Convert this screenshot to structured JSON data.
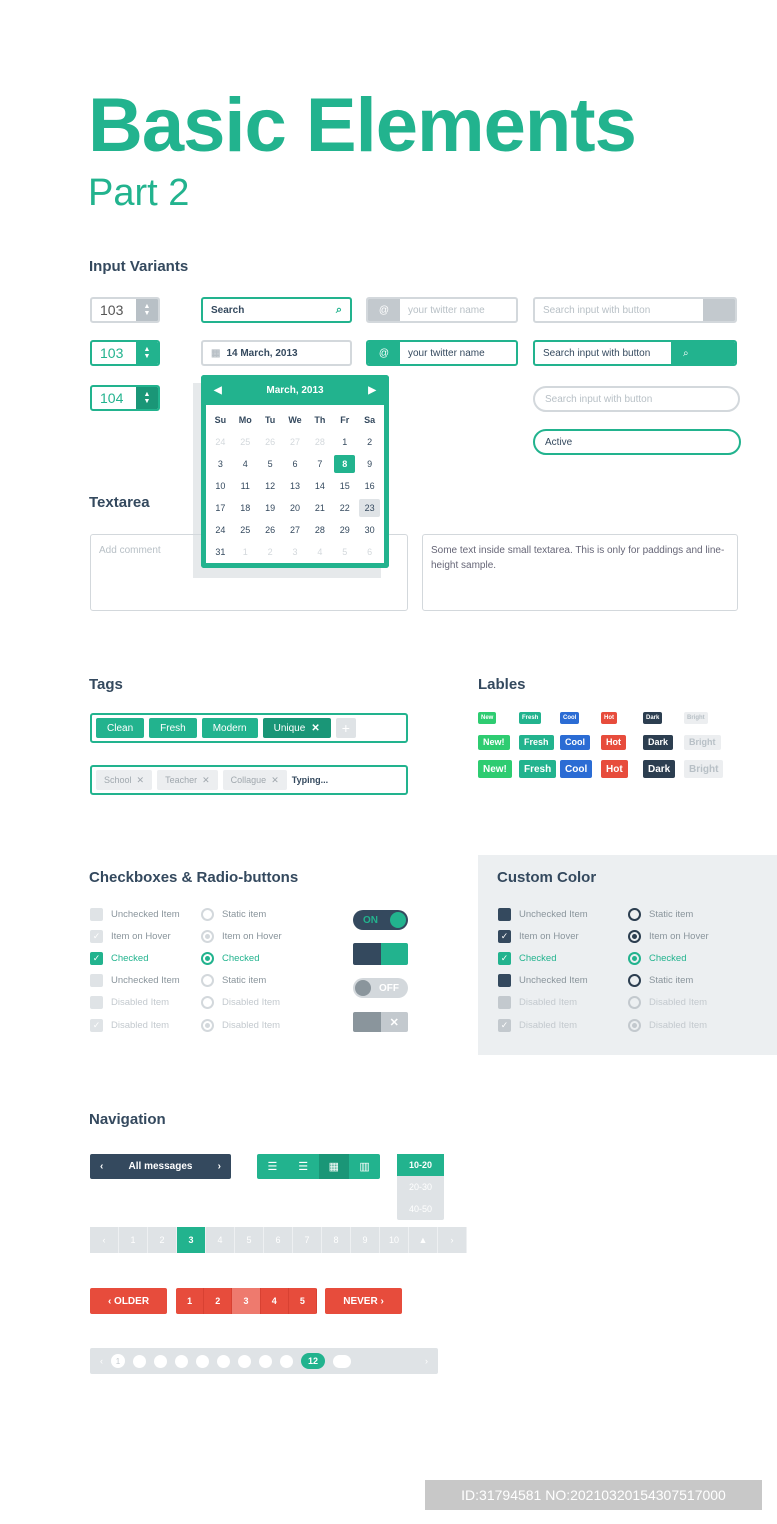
{
  "title": "Basic Elements",
  "subtitle": "Part 2",
  "colors": {
    "accent": "#22b38e",
    "dark": "#34495e",
    "red": "#e74c3c",
    "blue": "#2b6cd4",
    "grey": "#dfe3e6"
  },
  "inputs": {
    "heading": "Input Variants",
    "stepper1": "103",
    "stepper2": "103",
    "stepper3": "104",
    "search": "Search",
    "date": "14 March, 2013",
    "twitter_placeholder": "your twitter name",
    "twitter_value": "your twitter name",
    "sib_placeholder": "Search input with button",
    "sib_value": "Search input with button",
    "rounded_placeholder": "Search input with button",
    "active": "Active"
  },
  "calendar": {
    "month": "March, 2013",
    "weekdays": [
      "Su",
      "Mo",
      "Tu",
      "We",
      "Th",
      "Fr",
      "Sa"
    ],
    "days": [
      "24",
      "25",
      "26",
      "27",
      "28",
      "1",
      "2",
      "3",
      "4",
      "5",
      "6",
      "7",
      "8",
      "9",
      "10",
      "11",
      "12",
      "13",
      "14",
      "15",
      "16",
      "17",
      "18",
      "19",
      "20",
      "21",
      "22",
      "23",
      "24",
      "25",
      "26",
      "27",
      "28",
      "29",
      "30",
      "31",
      "1",
      "2",
      "3",
      "4",
      "5",
      "6"
    ],
    "selected": "8",
    "hover": "23"
  },
  "textarea": {
    "heading": "Textarea",
    "placeholder": "Add comment",
    "sample": "Some text inside small textarea. This is only for paddings and line-height sample."
  },
  "tags": {
    "heading": "Tags",
    "set1": [
      "Clean",
      "Fresh",
      "Modern",
      "Unique"
    ],
    "set2": [
      "School",
      "Teacher",
      "Collague"
    ],
    "typing": "Typing..."
  },
  "labels": {
    "heading": "Lables",
    "items": [
      "New",
      "Fresh",
      "Cool",
      "Hot",
      "Dark",
      "Bright"
    ],
    "items2": [
      "New!",
      "Fresh",
      "Cool",
      "Hot",
      "Dark",
      "Bright"
    ]
  },
  "checks": {
    "heading": "Checkboxes & Radio-buttons",
    "col1": [
      "Unchecked Item",
      "Item on Hover",
      "Checked",
      "Unchecked Item",
      "Disabled Item",
      "Disabled Item"
    ],
    "col2": [
      "Static item",
      "Item on Hover",
      "Checked",
      "Static item",
      "Disabled Item",
      "Disabled Item"
    ],
    "on": "ON",
    "off": "OFF",
    "x": "✕"
  },
  "custom": {
    "heading": "Custom Color",
    "col1": [
      "Unchecked Item",
      "Item on Hover",
      "Checked",
      "Unchecked Item",
      "Disabled Item",
      "Disabled Item"
    ],
    "col2": [
      "Static item",
      "Item on Hover",
      "Checked",
      "Static item",
      "Disabled Item",
      "Disabled Item"
    ]
  },
  "nav": {
    "heading": "Navigation",
    "all_messages": "All messages",
    "dropdown": [
      "10-20",
      "20-30",
      "40-50"
    ],
    "pages": [
      "1",
      "2",
      "3",
      "4",
      "5",
      "6",
      "7",
      "8",
      "9",
      "10"
    ],
    "current": "3",
    "older": "OLDER",
    "red_pages": [
      "1",
      "2",
      "3",
      "4",
      "5"
    ],
    "newer": "NEVER",
    "dot_first": "1",
    "dot_active": "12"
  },
  "footer": {
    "id": "ID:31794581 NO:20210320154307517000"
  }
}
